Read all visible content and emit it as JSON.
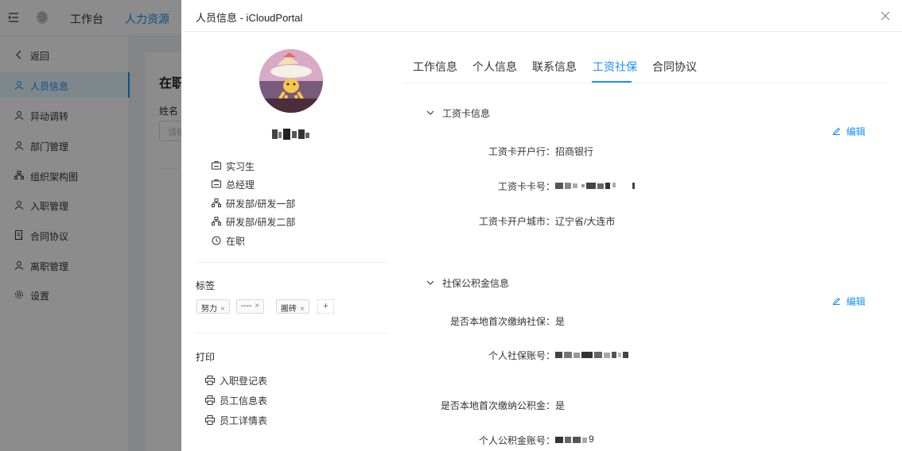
{
  "app": {
    "top_nav": [
      "工作台",
      "人力资源"
    ],
    "sidebar": [
      {
        "label": "返回",
        "icon": "chevron-left-icon"
      },
      {
        "label": "人员信息",
        "icon": "user-icon"
      },
      {
        "label": "异动调转",
        "icon": "user-icon"
      },
      {
        "label": "部门管理",
        "icon": "user-icon"
      },
      {
        "label": "组织架构图",
        "icon": "org-chart-icon"
      },
      {
        "label": "入职管理",
        "icon": "user-icon"
      },
      {
        "label": "合同协议",
        "icon": "document-icon"
      },
      {
        "label": "离职管理",
        "icon": "user-icon"
      },
      {
        "label": "设置",
        "icon": "gear-icon"
      }
    ],
    "bg_title": "在职",
    "bg_label": "姓名",
    "bg_input_placeholder": "请输"
  },
  "drawer": {
    "title": "人员信息 - iCloudPortal",
    "profile": {
      "rows": [
        {
          "icon": "id-card-icon",
          "text": "实习生"
        },
        {
          "icon": "id-card-icon",
          "text": "总经理"
        },
        {
          "icon": "org-chart-icon",
          "text": "研发部/研发一部"
        },
        {
          "icon": "org-chart-icon",
          "text": "研发部/研发二部"
        },
        {
          "icon": "clock-icon",
          "text": "在职"
        }
      ]
    },
    "tags_label": "标签",
    "tags": [
      "努力",
      "----",
      "搬砖"
    ],
    "print_label": "打印",
    "print_items": [
      "入职登记表",
      "员工信息表",
      "员工详情表"
    ],
    "tabs": [
      "工作信息",
      "个人信息",
      "联系信息",
      "工资社保",
      "合同协议"
    ],
    "active_tab": "工资社保",
    "salary_card": {
      "heading": "工资卡信息",
      "edit": "编辑",
      "fields": [
        {
          "label": "工资卡开户行：",
          "value": "招商银行"
        },
        {
          "label": "工资卡卡号：",
          "value": ""
        },
        {
          "label": "工资卡开户城市：",
          "value": "辽宁省/大连市"
        }
      ]
    },
    "social": {
      "heading": "社保公积金信息",
      "edit": "编辑",
      "fields": [
        {
          "label": "是否本地首次缴纳社保：",
          "value": "是"
        },
        {
          "label": "个人社保账号：",
          "value": ""
        },
        {
          "label": "是否本地首次缴纳公积金：",
          "value": "是"
        },
        {
          "label": "个人公积金账号：",
          "value": "9"
        }
      ]
    },
    "colors": {
      "accent": "#1890ff",
      "overlay": "rgba(0,0,0,0.45)"
    }
  }
}
